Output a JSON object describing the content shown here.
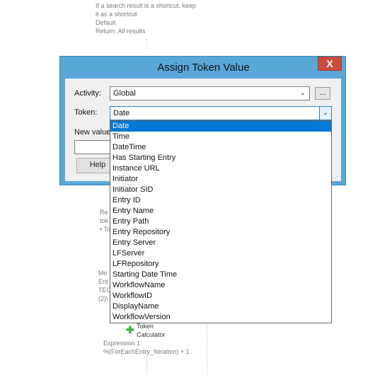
{
  "background": {
    "top_note": [
      "If a search result is a shortcut, keep",
      "it as a shortcut",
      "Default",
      "Return: All results"
    ],
    "left_partial_1": [
      "Re",
      "tok",
      "• To"
    ],
    "left_partial_2": [
      "Mo",
      "Ent",
      "TEC",
      "(2)\\"
    ],
    "token_calculator": [
      "Token",
      "Calculator"
    ],
    "expression": [
      "Expression 1:",
      "%(ForEachEntry_Iteration) + 1"
    ]
  },
  "dialog": {
    "title": "Assign Token Value",
    "close_label": "X",
    "activity_label": "Activity:",
    "activity_value": "Global",
    "browse_label": "...",
    "token_label": "Token:",
    "token_value": "Date",
    "new_value_label": "New value",
    "help_label": "Help"
  },
  "dropdown": {
    "selected_index": 0,
    "options": [
      "Date",
      "Time",
      "DateTime",
      "Has Starting Entry",
      "Instance URL",
      "Initiator",
      "Initiator SID",
      "Entry ID",
      "Entry Name",
      "Entry Path",
      "Entry Repository",
      "Entry Server",
      "LFServer",
      "LFRepository",
      "Starting Date Time",
      "WorkflowName",
      "WorkflowID",
      "DisplayName",
      "WorkflowVersion"
    ]
  },
  "icons": {
    "close": "close-icon",
    "chevron": "chevron-down-icon",
    "add": "plus-icon"
  },
  "colors": {
    "title_bar": "#5aa7d8",
    "selection": "#0078d7",
    "close": "#c94d3d"
  }
}
